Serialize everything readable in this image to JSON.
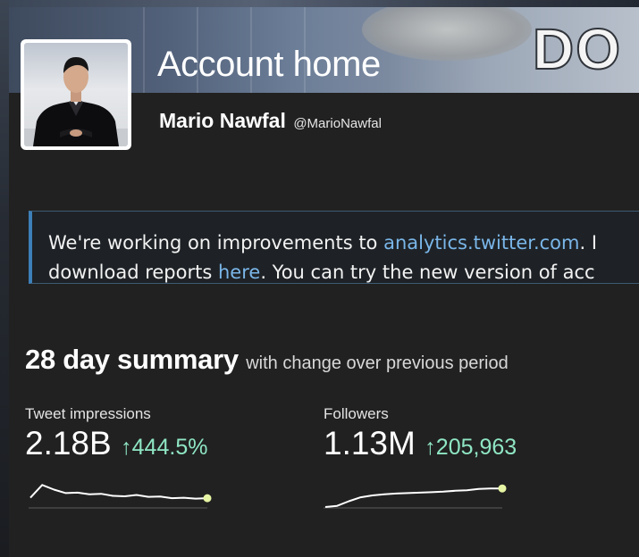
{
  "banner": {
    "text": "DO"
  },
  "header": {
    "title": "Account home",
    "name": "Mario Nawfal",
    "handle": "@MarioNawfal"
  },
  "notice": {
    "line1_prefix": "We're working on improvements to ",
    "line1_link": "analytics.twitter.com",
    "line1_suffix": ". I",
    "line2_prefix": "download reports ",
    "line2_link": "here",
    "line2_suffix": ". You can try the new version of acc"
  },
  "summary": {
    "title": "28 day summary",
    "subtitle": "with change over previous period"
  },
  "metrics": [
    {
      "label": "Tweet impressions",
      "value": "2.18B",
      "change": "↑444.5%",
      "trend": [
        0.4,
        0.95,
        0.75,
        0.6,
        0.62,
        0.55,
        0.57,
        0.48,
        0.46,
        0.52,
        0.44,
        0.45,
        0.38,
        0.4,
        0.36,
        0.38
      ]
    },
    {
      "label": "Followers",
      "value": "1.13M",
      "change": "↑205,963",
      "trend": [
        0.0,
        0.05,
        0.25,
        0.42,
        0.5,
        0.55,
        0.58,
        0.6,
        0.62,
        0.64,
        0.66,
        0.7,
        0.72,
        0.78,
        0.8,
        0.8
      ]
    }
  ],
  "colors": {
    "background": "#212121",
    "link": "#7ab6e9",
    "positive_change": "#8fe6c4",
    "sparkline_dot": "#e6f5a4",
    "notice_border": "#3d7fb8"
  }
}
